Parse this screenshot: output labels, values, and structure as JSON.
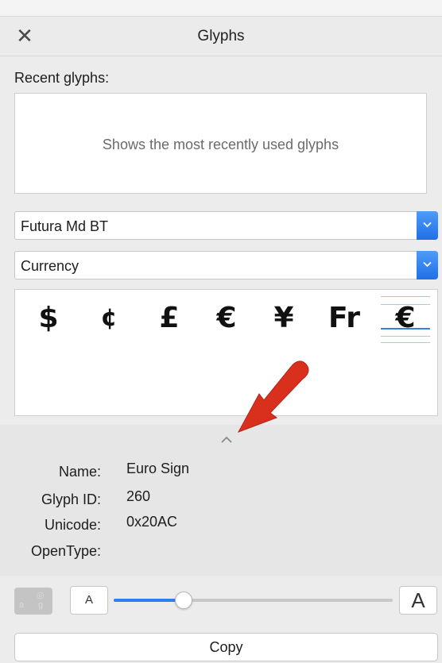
{
  "window": {
    "title": "Glyphs"
  },
  "recent": {
    "label": "Recent glyphs:",
    "placeholder": "Shows the most recently used glyphs"
  },
  "font_select": {
    "value": "Futura Md BT"
  },
  "category_select": {
    "value": "Currency"
  },
  "glyphs": [
    "$",
    "¢",
    "£",
    "€",
    "¥",
    "Fr",
    "€"
  ],
  "selected_glyph_index": 6,
  "info": {
    "name_label": "Name:",
    "name_value": "Euro Sign",
    "glyph_id_label": "Glyph ID:",
    "glyph_id_value": "260",
    "unicode_label": "Unicode:",
    "unicode_value": "0x20AC",
    "opentype_label": "OpenType:",
    "opentype_value": ""
  },
  "size_controls": {
    "small_label": "A",
    "large_label": "A",
    "slider_value": 0.25
  },
  "copy_button": {
    "label": "Copy"
  },
  "colors": {
    "accent": "#2f7ff3",
    "annotation_arrow": "#d9301e"
  },
  "icons": {
    "close": "close-icon",
    "dropdown": "chevron-down-icon",
    "collapse": "chevron-up-icon",
    "preview": "glyph-preview-icon",
    "annotation": "arrow-annotation-icon"
  }
}
